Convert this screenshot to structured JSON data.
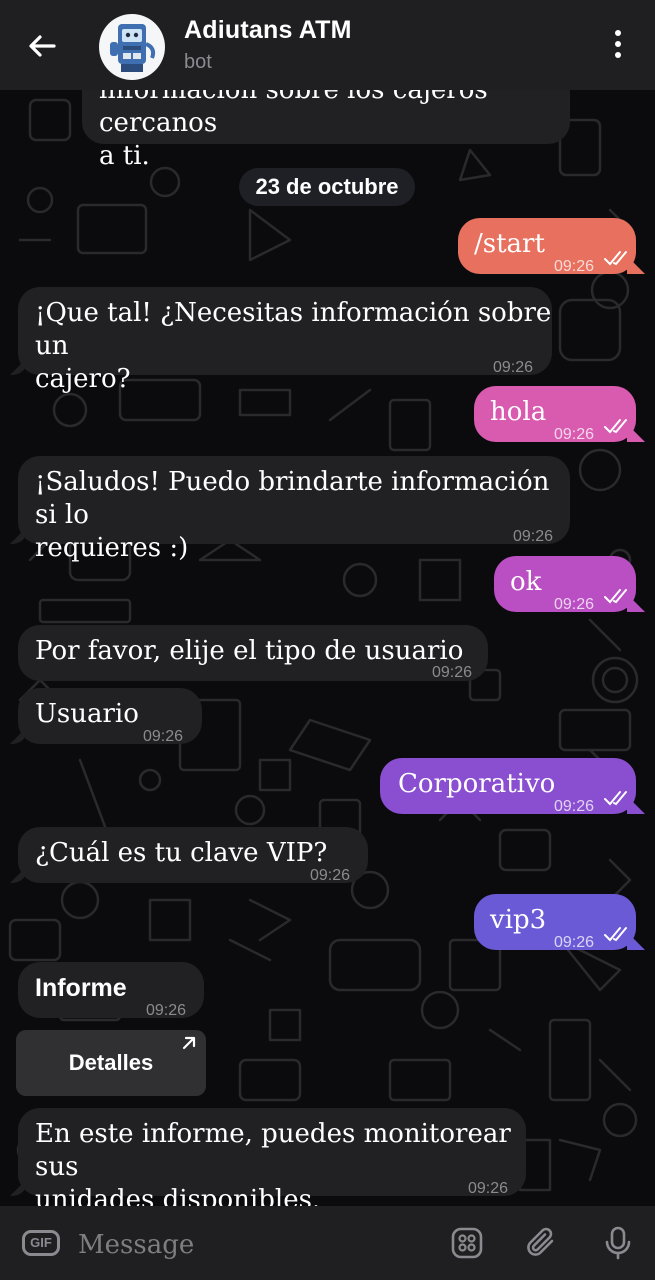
{
  "header": {
    "back_icon": "arrow-left-icon",
    "title": "Adiutans ATM",
    "subtitle": "bot",
    "menu_icon": "more-vertical-icon"
  },
  "date_label": "23 de octubre",
  "messages": [
    {
      "side": "in",
      "text_line1": "información sobre los cajeros cercanos",
      "text_line2": "a ti."
    },
    {
      "side": "out",
      "text": "/start",
      "time": "09:26",
      "color": "#e8705f"
    },
    {
      "side": "in",
      "text_line1": "¡Que tal! ¿Necesitas información sobre un",
      "text_line2": "cajero?",
      "time": "09:26"
    },
    {
      "side": "out",
      "text": "hola",
      "time": "09:26",
      "color": "#d85bb0"
    },
    {
      "side": "in",
      "text_line1": "¡Saludos! Puedo brindarte información si lo",
      "text_line2": "requieres :)",
      "time": "09:26"
    },
    {
      "side": "out",
      "text": "ok",
      "time": "09:26",
      "color": "#b94fc2"
    },
    {
      "side": "in",
      "text": "Por favor, elije el tipo de usuario",
      "time": "09:26"
    },
    {
      "side": "in",
      "text": "Usuario",
      "time": "09:26"
    },
    {
      "side": "out",
      "text": "Corporativo",
      "time": "09:26",
      "color": "#8a4ed0"
    },
    {
      "side": "in",
      "text": "¿Cuál es tu clave VIP?",
      "time": "09:26"
    },
    {
      "side": "out",
      "text": "vip3",
      "time": "09:26",
      "color": "#6a5ad6"
    },
    {
      "side": "in",
      "text": "Informe",
      "time": "09:26"
    },
    {
      "side": "in",
      "text_line1": "En este informe, puedes monitorear sus",
      "text_line2": "unidades disponibles.",
      "time": "09:26"
    }
  ],
  "inline_button": {
    "label": "Detalles",
    "icon": "external-arrow-icon"
  },
  "input": {
    "placeholder": "Message",
    "gif_label": "GIF",
    "icons": [
      "gif-icon",
      "bot-commands-icon",
      "attach-icon",
      "microphone-icon"
    ]
  }
}
